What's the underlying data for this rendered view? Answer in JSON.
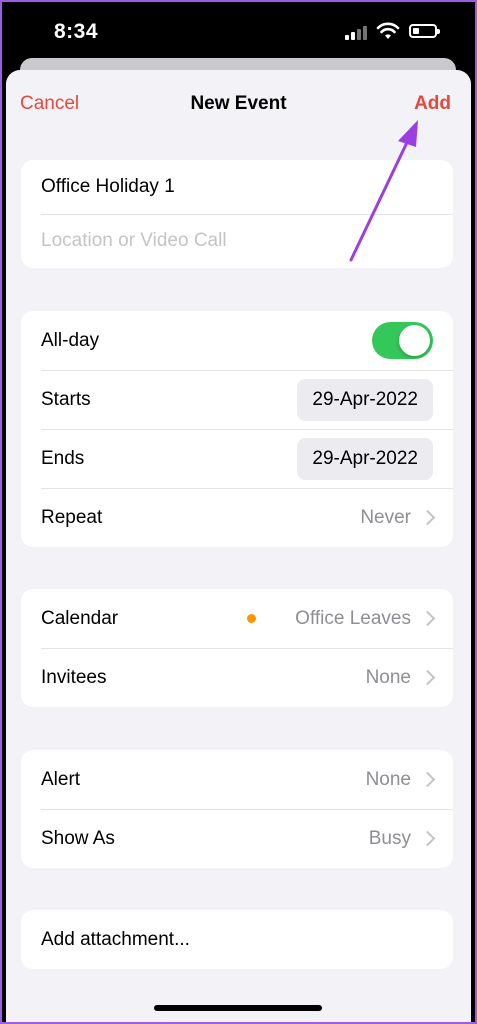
{
  "status_bar": {
    "time": "8:34"
  },
  "nav": {
    "cancel": "Cancel",
    "title": "New Event",
    "add": "Add"
  },
  "details": {
    "title_value": "Office Holiday 1",
    "location_placeholder": "Location or Video Call"
  },
  "schedule": {
    "allday_label": "All-day",
    "allday_on": true,
    "starts_label": "Starts",
    "starts_value": "29-Apr-2022",
    "ends_label": "Ends",
    "ends_value": "29-Apr-2022",
    "repeat_label": "Repeat",
    "repeat_value": "Never"
  },
  "calendar_section": {
    "calendar_label": "Calendar",
    "calendar_value": "Office Leaves",
    "calendar_color": "#ff9500",
    "invitees_label": "Invitees",
    "invitees_value": "None"
  },
  "alert_section": {
    "alert_label": "Alert",
    "alert_value": "None",
    "showas_label": "Show As",
    "showas_value": "Busy"
  },
  "attachment": {
    "label": "Add attachment..."
  },
  "colors": {
    "accent": "#e8483c",
    "toggle_on": "#34c759",
    "annotation_arrow": "#9b3fe0"
  }
}
